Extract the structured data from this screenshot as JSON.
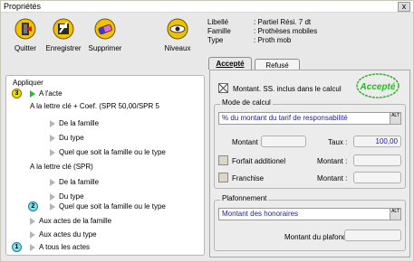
{
  "window": {
    "title": "Propriétés",
    "close_glyph": "x"
  },
  "toolbar": {
    "buttons": [
      {
        "label": "Quitter",
        "icon": "exit-icon"
      },
      {
        "label": "Enregistrer",
        "icon": "save-icon"
      },
      {
        "label": "Supprimer",
        "icon": "eraser-icon"
      },
      {
        "label": "Niveaux",
        "icon": "eye-icon"
      }
    ]
  },
  "info": {
    "rows": [
      {
        "key": "Libellé",
        "value": ": Partiel Rési. 7 dt"
      },
      {
        "key": "Famille",
        "value": ": Prothèses mobiles"
      },
      {
        "key": "Type",
        "value": ": Proth mob"
      }
    ]
  },
  "left": {
    "header": "Appliquer",
    "items": [
      {
        "text": "A l'acte",
        "badge": "3"
      },
      {
        "text": "A la lettre clé + Coef.   (SPR 50,00/SPR 5"
      },
      {
        "text": "De la famille"
      },
      {
        "text": "Du type"
      },
      {
        "text": "Quel que soit la famille ou le type"
      },
      {
        "text": "A la lettre clé          (SPR)"
      },
      {
        "text": "De la famille"
      },
      {
        "text": "Du type"
      },
      {
        "text": "Quel que soit la famille ou le type",
        "badge": "2"
      },
      {
        "text": "Aux actes de la famille"
      },
      {
        "text": "Aux actes du type"
      },
      {
        "text": "A tous les actes",
        "badge": "1"
      }
    ]
  },
  "tabs": {
    "accepted": "Accepté",
    "refused": "Refusé"
  },
  "right": {
    "ss_check_label": "Montant. SS. inclus dans le calcul",
    "stamp_text": "Accepté",
    "mode": {
      "title": "Mode de calcul",
      "selected": "% du montant du tarif de responsabilité",
      "montant_label": "Montant :",
      "taux_label": "Taux :",
      "taux_value": "100,00",
      "forfait_label": "Forfait additionel",
      "franchise_label": "Franchise",
      "montant2_label": "Montant :",
      "montant3_label": "Montant :"
    },
    "plafond": {
      "title": "Plafonnement",
      "selected": "Montant des honoraires",
      "plafond_label": "Montant du plafond"
    },
    "dd_glyph": "ALT"
  },
  "colors": {
    "accent_green": "#2fb62a",
    "text_blue": "#1e1e9a"
  }
}
